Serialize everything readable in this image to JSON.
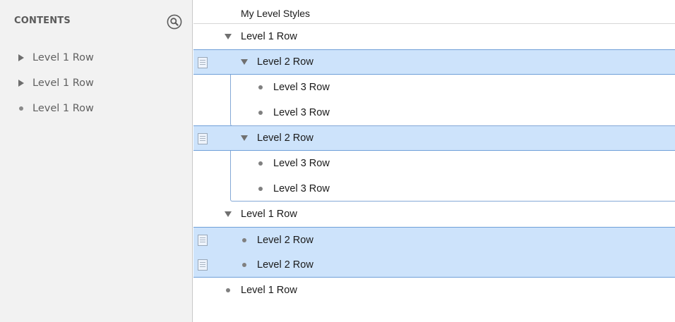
{
  "sidebar": {
    "header": "CONTENTS",
    "search_icon": "magnifier-circle-icon",
    "items": [
      {
        "label": "Level 1 Row",
        "marker": "triangle-right"
      },
      {
        "label": "Level 1 Row",
        "marker": "triangle-right"
      },
      {
        "label": "Level 1 Row",
        "marker": "dot"
      }
    ]
  },
  "outline": {
    "title": "My Level Styles",
    "rows": [
      {
        "label": "Level 1 Row",
        "level": 1,
        "marker": "triangle-down",
        "selected": false
      },
      {
        "label": "Level 2 Row",
        "level": 2,
        "marker": "triangle-down",
        "selected": true,
        "note_icon": true
      },
      {
        "label": "Level 3 Row",
        "level": 3,
        "marker": "dot",
        "selected": false
      },
      {
        "label": "Level 3 Row",
        "level": 3,
        "marker": "dot",
        "selected": false
      },
      {
        "label": "Level 2 Row",
        "level": 2,
        "marker": "triangle-down",
        "selected": true,
        "note_icon": true
      },
      {
        "label": "Level 3 Row",
        "level": 3,
        "marker": "dot",
        "selected": false
      },
      {
        "label": "Level 3 Row",
        "level": 3,
        "marker": "dot",
        "selected": false
      },
      {
        "label": "Level 1 Row",
        "level": 1,
        "marker": "triangle-down",
        "selected": false
      },
      {
        "label": "Level 2 Row",
        "level": 2,
        "marker": "dot",
        "selected": true,
        "note_icon": true
      },
      {
        "label": "Level 2 Row",
        "level": 2,
        "marker": "dot",
        "selected": true,
        "note_icon": true
      },
      {
        "label": "Level 1 Row",
        "level": 1,
        "marker": "dot",
        "selected": false
      }
    ]
  },
  "colors": {
    "selection_fill": "#cde3fb",
    "selection_border": "#6f9fd8",
    "sidebar_bg": "#f2f2f2"
  }
}
